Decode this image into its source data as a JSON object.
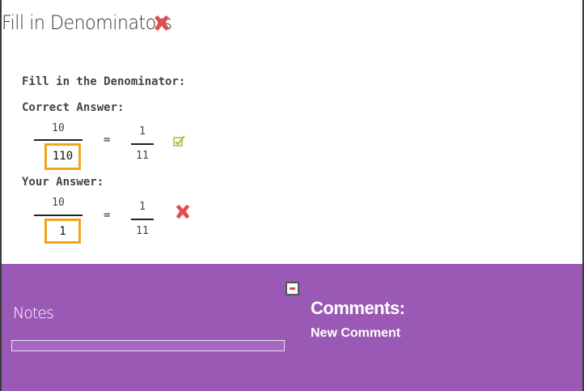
{
  "title": "Fill in Denominators",
  "prompt": "Fill in the Denominator:",
  "correct": {
    "label": "Correct Answer:",
    "left_numerator": "10",
    "left_denominator": "110",
    "equals": "=",
    "right_numerator": "1",
    "right_denominator": "11"
  },
  "yours": {
    "label": "Your Answer:",
    "left_numerator": "10",
    "left_denominator": "1",
    "equals": "=",
    "right_numerator": "1",
    "right_denominator": "11"
  },
  "footer": {
    "notes_label": "Notes",
    "notes_value": "",
    "comments_title": "Comments:",
    "new_comment_label": "New Comment"
  },
  "colors": {
    "accent": "#9a59b5",
    "answer_box_border": "#f0a51c",
    "error": "#e24c4c",
    "check": "#9bc53d"
  },
  "icons": {
    "title_close": "close-x-icon",
    "correct_status": "checkmark-icon",
    "your_status": "wrong-x-icon",
    "collapse": "minus-icon"
  }
}
